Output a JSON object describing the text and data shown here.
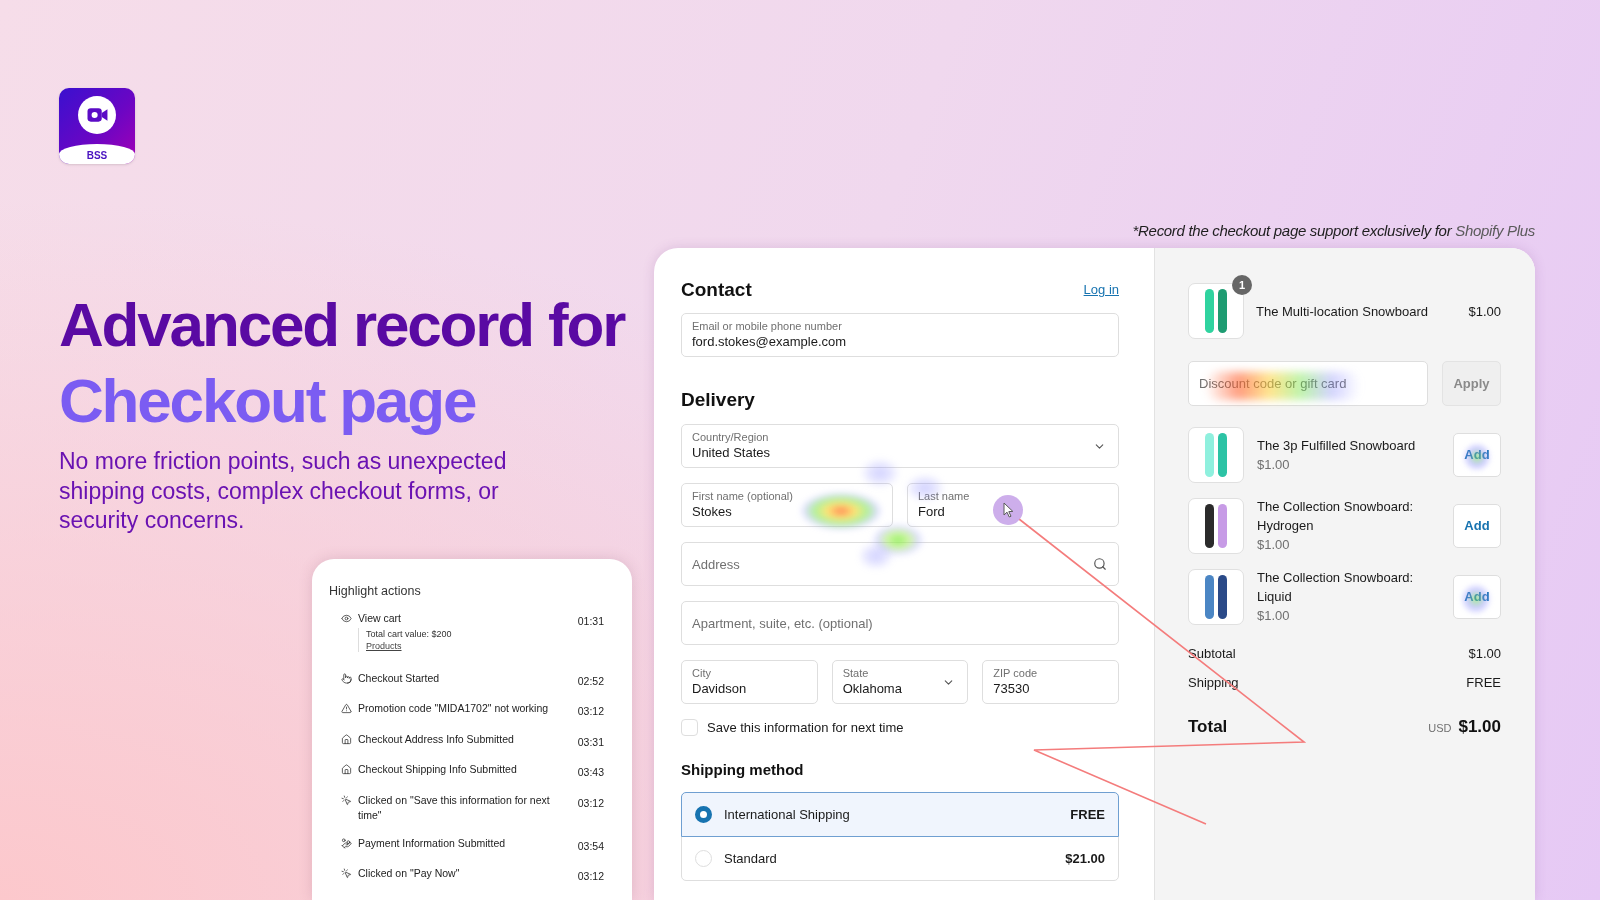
{
  "logo": {
    "label": "BSS"
  },
  "headline": {
    "title": "Advanced record for",
    "accent": "Checkout page",
    "description": "No more friction points, such as unexpected shipping costs, complex checkout forms, or security concerns."
  },
  "highlight_actions": {
    "title": "Highlight actions",
    "items": [
      {
        "kind": "view",
        "label": "View cart",
        "time": "01:31",
        "detail": "Total cart value: $200",
        "link": "Products"
      },
      {
        "kind": "checkout",
        "label": "Checkout Started",
        "time": "02:52"
      },
      {
        "kind": "warning",
        "label": "Promotion code \"MIDA1702\" not working",
        "time": "03:12"
      },
      {
        "kind": "submit",
        "label": "Checkout Address Info Submitted",
        "time": "03:31"
      },
      {
        "kind": "submit",
        "label": "Checkout Shipping Info Submitted",
        "time": "03:43"
      },
      {
        "kind": "click",
        "label": "Clicked on \"Save this information for next time\"",
        "time": "03:12"
      },
      {
        "kind": "payment",
        "label": "Payment Information Submitted",
        "time": "03:54"
      },
      {
        "kind": "click",
        "label": "Clicked on \"Pay Now\"",
        "time": "03:12"
      }
    ]
  },
  "note": {
    "text": "*Record the checkout page support exclusively for",
    "brand": "Shopify Plus"
  },
  "checkout": {
    "contact": {
      "heading": "Contact",
      "link": "Log in",
      "field": {
        "kind": "text",
        "label": "Email or mobile phone number",
        "value": "ford.stokes@example.com"
      }
    },
    "delivery": {
      "heading": "Delivery",
      "rows": [
        [
          {
            "kind": "select",
            "label": "Country/Region",
            "value": "United States"
          }
        ],
        [
          {
            "kind": "text",
            "label": "First name (optional)",
            "value": "Stokes"
          },
          {
            "kind": "text",
            "label": "Last name",
            "value": "Ford"
          }
        ],
        [
          {
            "kind": "search",
            "placeholder": "Address"
          }
        ],
        [
          {
            "kind": "text",
            "placeholder": "Apartment, suite, etc. (optional)"
          }
        ],
        [
          {
            "kind": "text",
            "label": "City",
            "value": "Davidson"
          },
          {
            "kind": "select",
            "label": "State",
            "value": "Oklahoma"
          },
          {
            "kind": "text",
            "label": "ZIP code",
            "value": "73530"
          }
        ]
      ]
    },
    "save_info": {
      "label": "Save this information for next time",
      "checked": false
    },
    "shipping": {
      "heading": "Shipping method",
      "options": [
        {
          "label": "International Shipping",
          "price": "FREE",
          "selected": true
        },
        {
          "label": "Standard",
          "price": "$21.00",
          "selected": false
        }
      ]
    }
  },
  "summary": {
    "cart_items": [
      {
        "name": "The Multi-location Snowboard",
        "price": "$1.00",
        "quantity": "1"
      }
    ],
    "discount": {
      "placeholder": "Discount code or gift card",
      "button": "Apply",
      "disabled": true
    },
    "recommendations": [
      {
        "name": "The 3p Fulfilled Snowboard",
        "price": "$1.00",
        "button": "Add"
      },
      {
        "name": "The Collection Snowboard: Hydrogen",
        "price": "$1.00",
        "button": "Add"
      },
      {
        "name": "The Collection Snowboard: Liquid",
        "price": "$1.00",
        "button": "Add"
      }
    ],
    "subtotal": {
      "label": "Subtotal",
      "value": "$1.00"
    },
    "shipping": {
      "label": "Shipping",
      "value": "FREE"
    },
    "total": {
      "label": "Total",
      "currency": "USD",
      "value": "$1.00"
    }
  }
}
